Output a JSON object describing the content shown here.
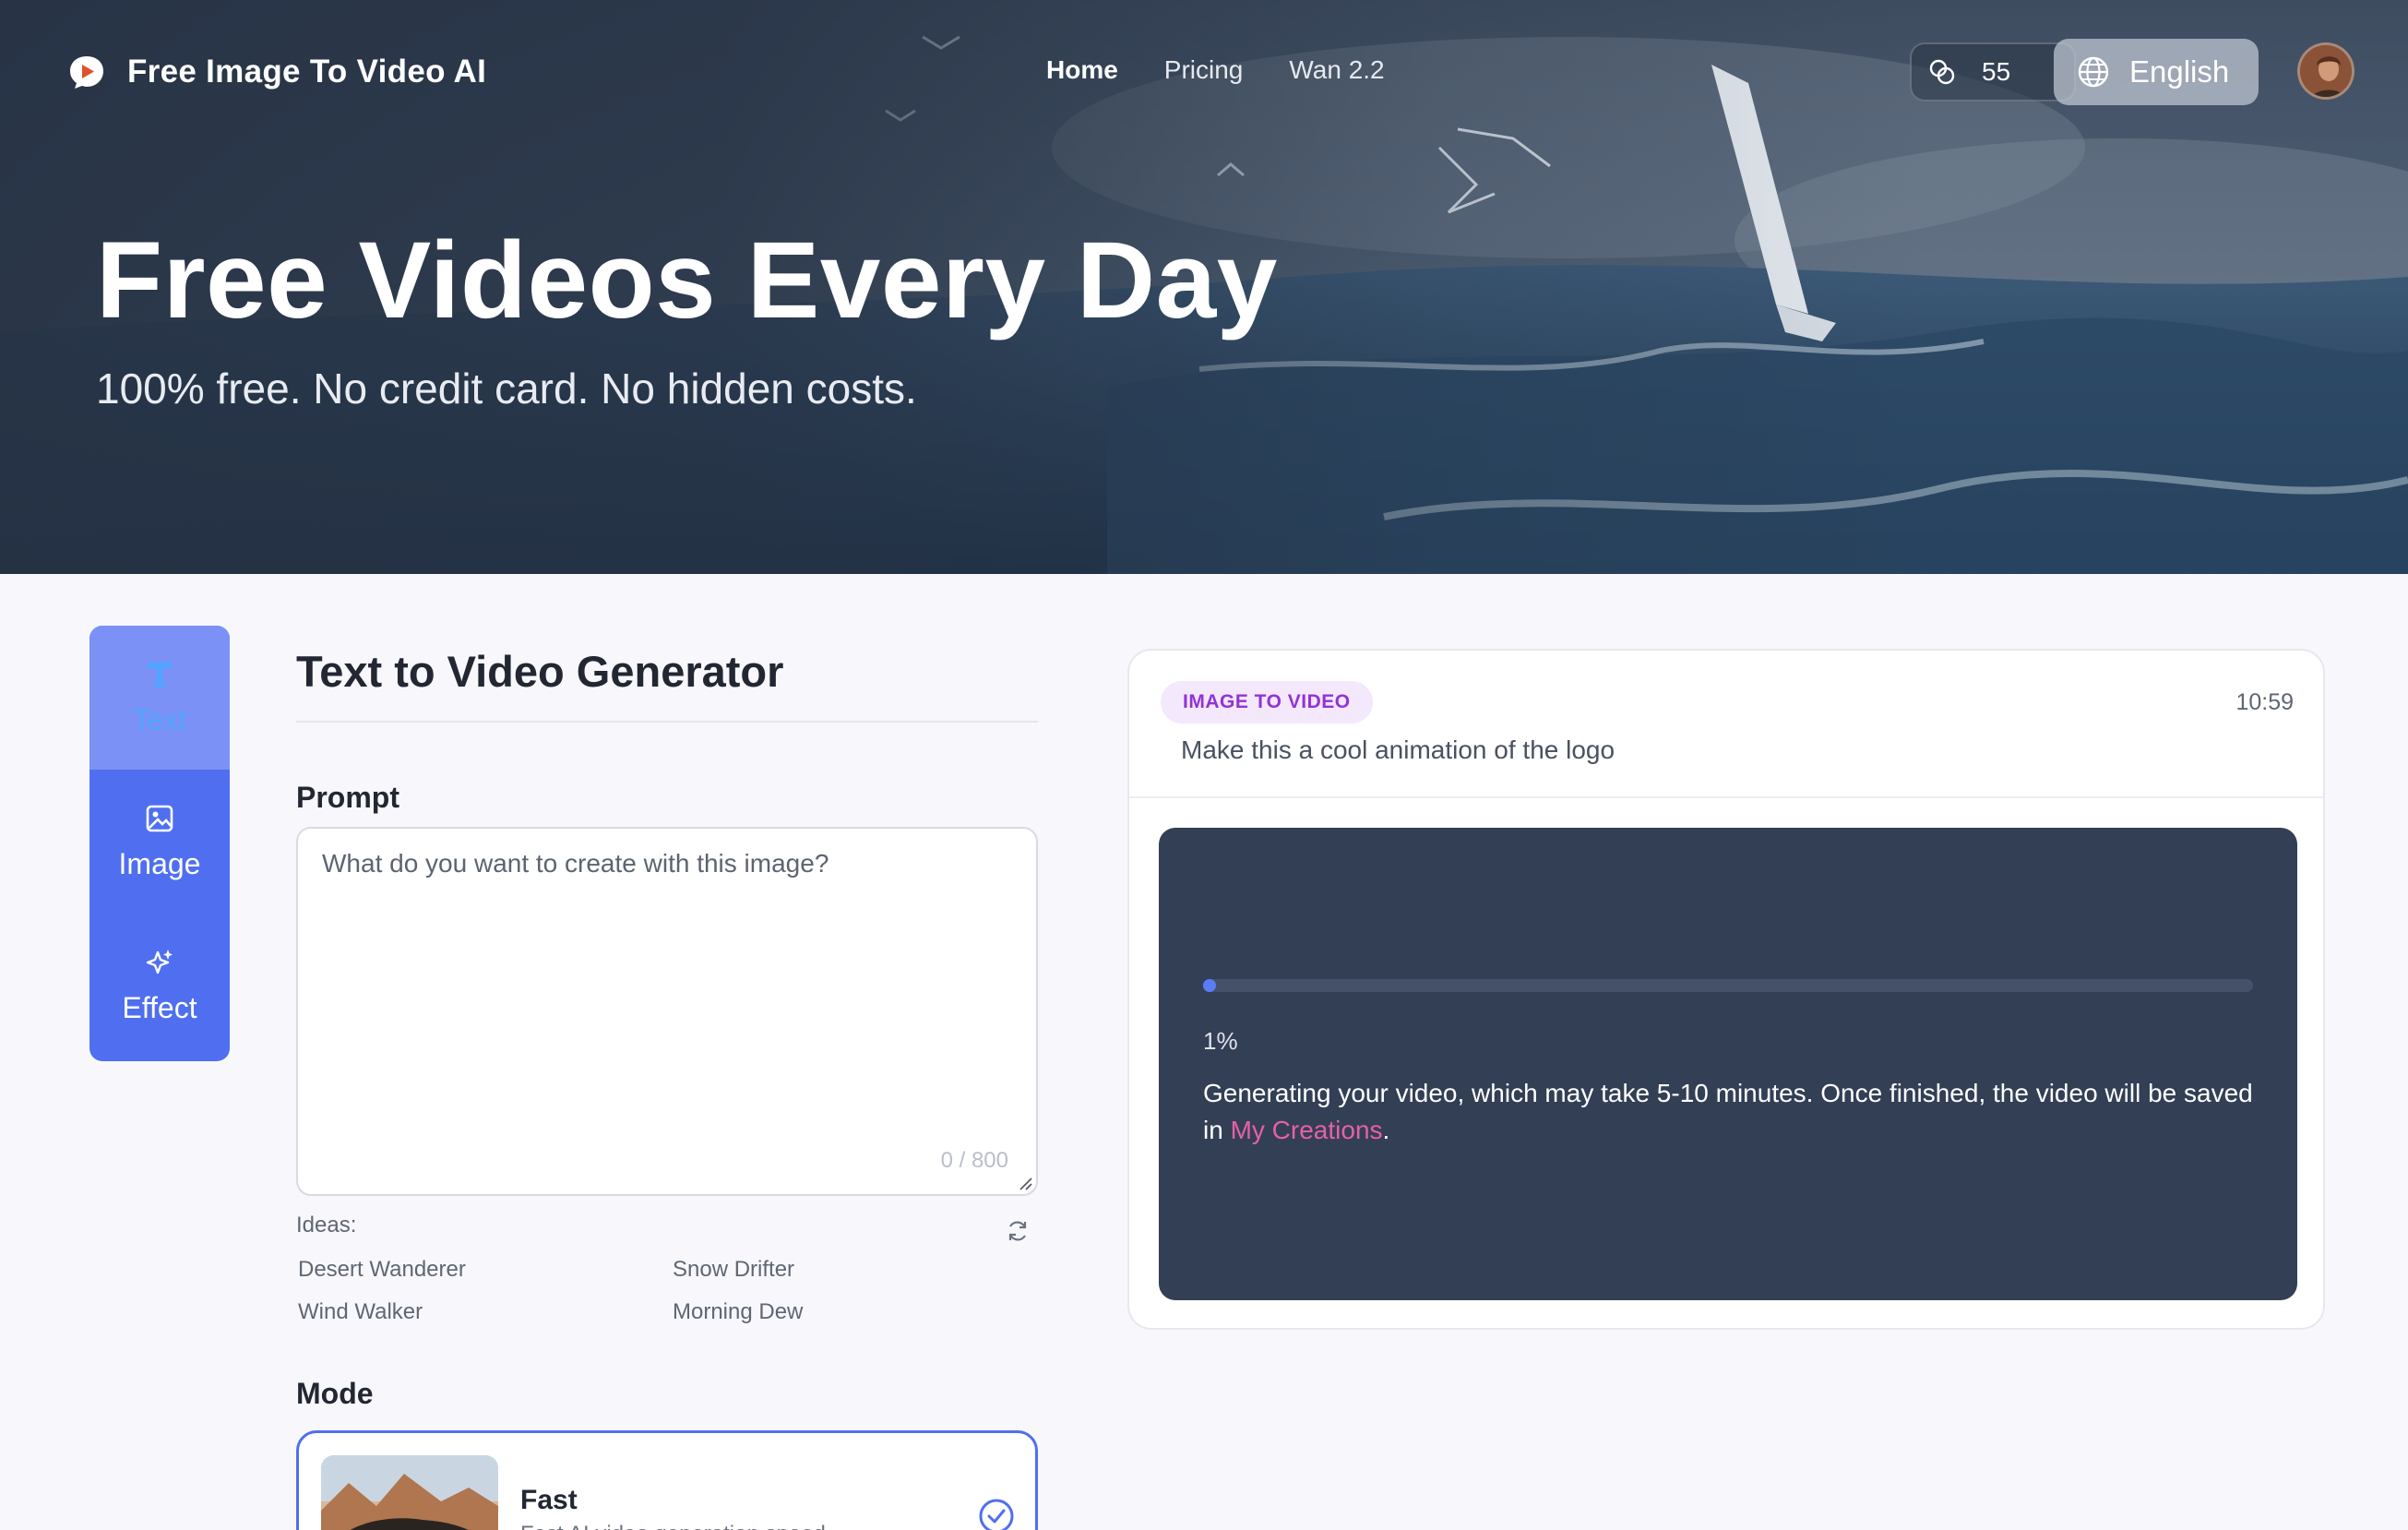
{
  "nav": {
    "brand": "Free Image To Video AI",
    "links": [
      "Home",
      "Pricing",
      "Wan 2.2"
    ],
    "credits": "55",
    "language": "English"
  },
  "hero": {
    "title": "Free Videos Every Day",
    "subtitle": "100% free. No credit card. No hidden costs."
  },
  "side_tabs": [
    "Text",
    "Image",
    "Effect"
  ],
  "form": {
    "title": "Text to Video Generator",
    "prompt_label": "Prompt",
    "prompt_placeholder": "What do you want to create with this image?",
    "counter": "0 / 800",
    "ideas_label": "Ideas:",
    "ideas": [
      "Desert Wanderer",
      "Snow Drifter",
      "Wind Walker",
      "Morning Dew"
    ],
    "mode_label": "Mode",
    "mode": {
      "name": "Fast",
      "description": "Fast AI video generation speed"
    }
  },
  "result": {
    "badge": "IMAGE TO VIDEO",
    "time": "10:59",
    "prompt": "Make this a cool animation of the logo",
    "progress": 0.01,
    "progress_text": "1%",
    "message_prefix": "Generating your video, which may take 5-10 minutes. Once finished, the video will be saved in ",
    "message_link": "My Creations",
    "message_suffix": "."
  },
  "colors": {
    "accent": "#4f6ff0",
    "badge_text": "#9233d6",
    "link": "#e660a8",
    "player_bg": "#333f55"
  },
  "icons": [
    "play-bubble-icon",
    "coins-icon",
    "globe-icon",
    "text-icon",
    "image-icon",
    "sparkle-icon",
    "refresh-icon",
    "check-circle-icon"
  ]
}
